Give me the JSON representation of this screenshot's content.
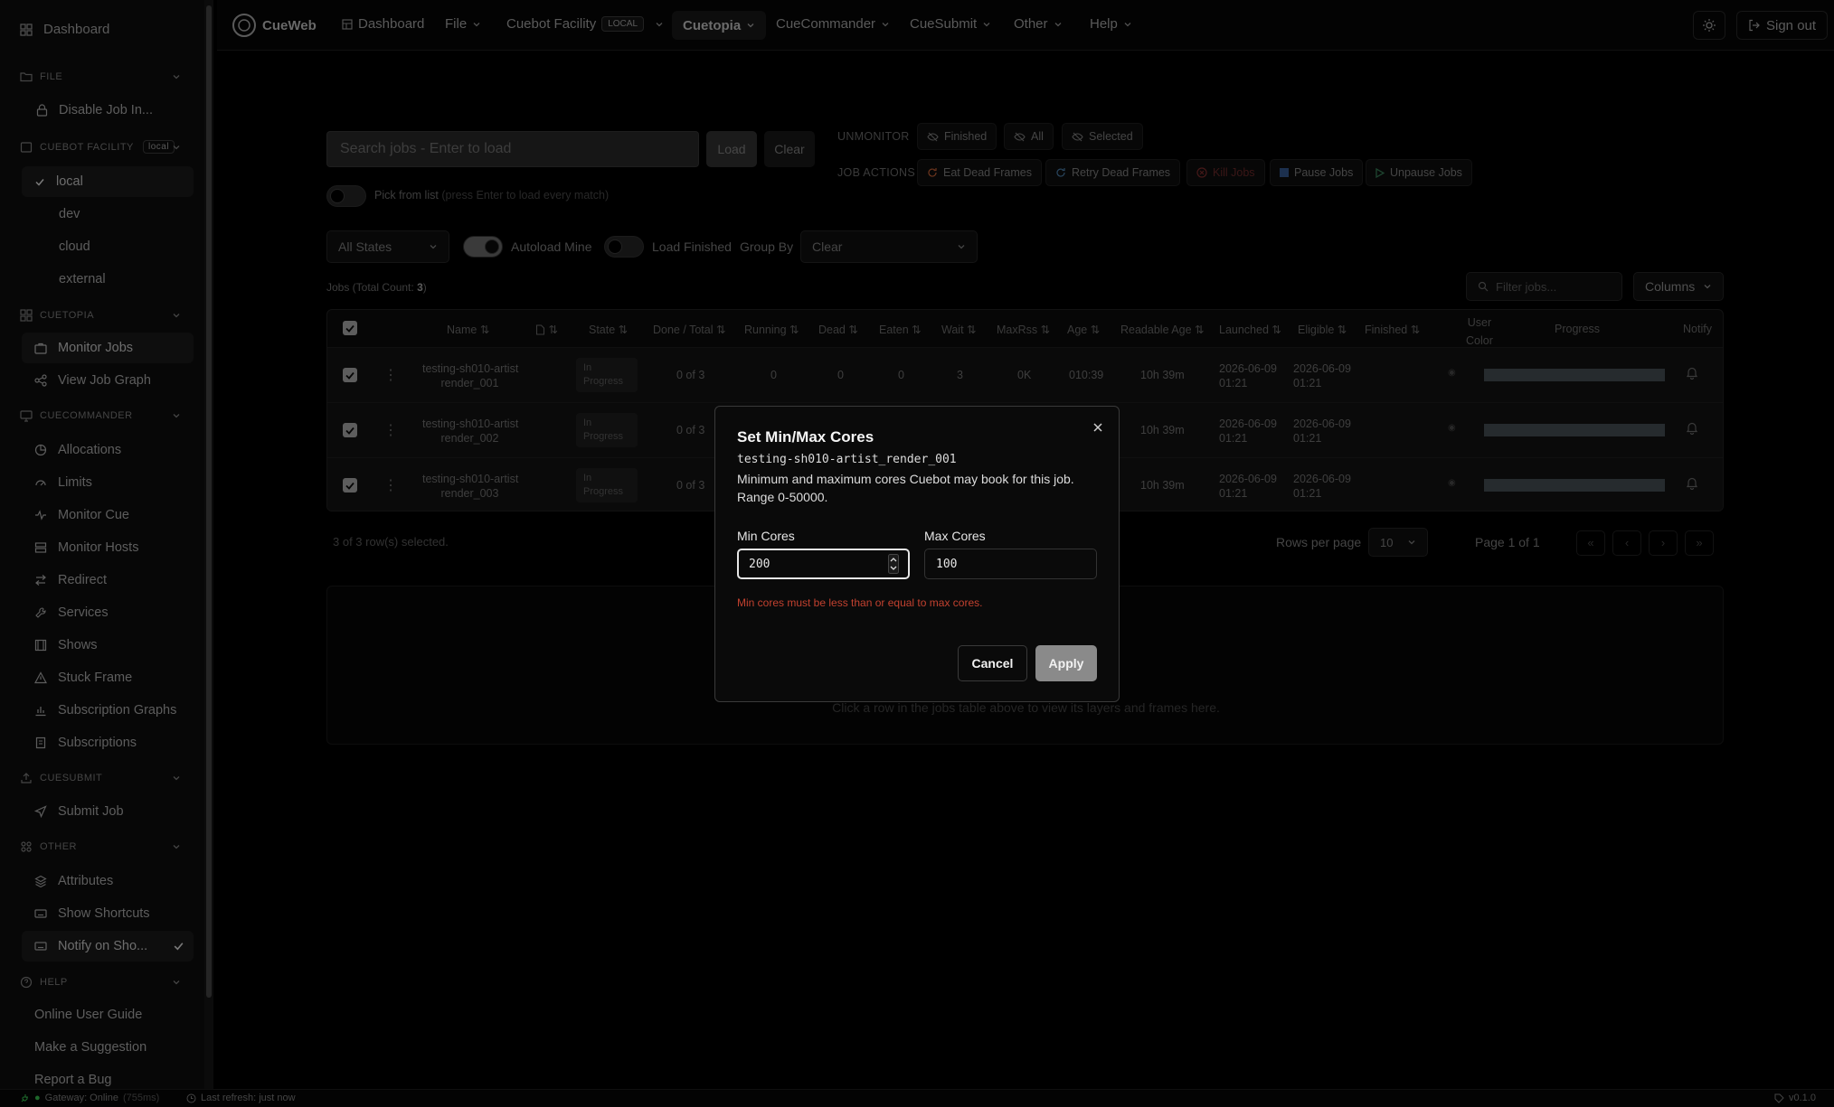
{
  "sidebar": {
    "dashboard": "Dashboard",
    "groups": {
      "file": "FILE",
      "cuebot_facility": "CUEBOT FACILITY",
      "cuebot_badge": "local",
      "cuetopia": "CUETOPIA",
      "cuecommander": "CUECOMMANDER",
      "cuesubmit": "CUESUBMIT",
      "other": "OTHER",
      "help": "HELP"
    },
    "items": {
      "disable_job": "Disable Job In...",
      "local": "local",
      "dev": "dev",
      "cloud": "cloud",
      "external": "external",
      "monitor_jobs": "Monitor Jobs",
      "view_job_graph": "View Job Graph",
      "allocations": "Allocations",
      "limits": "Limits",
      "monitor_cue": "Monitor Cue",
      "monitor_hosts": "Monitor Hosts",
      "redirect": "Redirect",
      "services": "Services",
      "shows": "Shows",
      "stuck_frame": "Stuck Frame",
      "subscription_graphs": "Subscription Graphs",
      "subscriptions": "Subscriptions",
      "submit_job": "Submit Job",
      "attributes": "Attributes",
      "show_shortcuts": "Show Shortcuts",
      "notify_on_show": "Notify on Sho...",
      "online_user_guide": "Online User Guide",
      "make_suggestion": "Make a Suggestion",
      "report_bug": "Report a Bug"
    }
  },
  "topbar": {
    "brand": "CueWeb",
    "dashboard": "Dashboard",
    "file": "File",
    "facility": "Cuebot Facility",
    "facility_badge": "LOCAL",
    "cuetopia": "Cuetopia",
    "cuecommander": "CueCommander",
    "cuesubmit": "CueSubmit",
    "other": "Other",
    "help": "Help",
    "sign_out": "Sign out"
  },
  "toolbar": {
    "search_placeholder": "Search jobs - Enter to load",
    "load": "Load",
    "clear": "Clear",
    "unmonitor_label": "UNMONITOR",
    "finished": "Finished",
    "all": "All",
    "selected": "Selected",
    "job_actions_label": "JOB ACTIONS",
    "eat_dead_frames": "Eat Dead Frames",
    "retry_dead_frames": "Retry Dead Frames",
    "kill_jobs": "Kill Jobs",
    "pause_jobs": "Pause Jobs",
    "unpause_jobs": "Unpause Jobs",
    "pick_from_list": "Pick from list",
    "pick_hint": "(press Enter to load every match)",
    "all_states": "All States",
    "autoload_mine": "Autoload Mine",
    "load_finished": "Load Finished",
    "group_by": "Group By",
    "group_by_value": "Clear"
  },
  "jobs": {
    "count_label": "Jobs (Total Count: ",
    "count": "3",
    "count_close": ")",
    "filter_placeholder": "Filter jobs...",
    "columns_btn": "Columns",
    "headers": {
      "name": "Name",
      "state": "State",
      "done_total": "Done / Total",
      "running": "Running",
      "dead": "Dead",
      "eaten": "Eaten",
      "wait": "Wait",
      "maxrss": "MaxRss",
      "age": "Age",
      "readable_age": "Readable Age",
      "launched": "Launched",
      "eligible": "Eligible",
      "finished": "Finished",
      "user_color_1": "User",
      "user_color_2": "Color",
      "progress": "Progress",
      "notify": "Notify"
    },
    "rows": [
      {
        "name1": "testing-sh010-artist",
        "name2": "render_001",
        "state1": "In",
        "state2": "Progress",
        "done": "0 of 3",
        "running": "0",
        "dead": "0",
        "eaten": "0",
        "wait": "3",
        "maxrss": "0K",
        "age": "010:39",
        "readable_age": "10h 39m",
        "launched1": "2026-06-09",
        "launched2": "01:21",
        "eligible1": "2026-06-09",
        "eligible2": "01:21",
        "progress": 1.0
      },
      {
        "name1": "testing-sh010-artist",
        "name2": "render_002",
        "state1": "In",
        "state2": "Progress",
        "done": "0 of 3",
        "readable_age": "10h 39m",
        "launched1": "2026-06-09",
        "launched2": "01:21",
        "eligible1": "2026-06-09",
        "eligible2": "01:21",
        "progress": 1.0
      },
      {
        "name1": "testing-sh010-artist",
        "name2": "render_003",
        "state1": "In",
        "state2": "Progress",
        "done": "0 of 3",
        "readable_age": "10h 39m",
        "launched1": "2026-06-09",
        "launched2": "01:21",
        "eligible1": "2026-06-09",
        "eligible2": "01:21",
        "progress": 1.0
      }
    ],
    "selected_text": "3 of 3 row(s) selected.",
    "rows_per_page": "Rows per page",
    "rows_per_page_value": "10",
    "page_text": "Page 1 of 1"
  },
  "lower_panel": {
    "hint": "Click a row in the jobs table above to view its layers and frames here."
  },
  "modal": {
    "title": "Set Min/Max Cores",
    "job_name": "testing-sh010-artist_render_001",
    "description": "Minimum and maximum cores Cuebot may book for this job. Range 0-50000.",
    "min_label": "Min Cores",
    "min_value": "200",
    "max_label": "Max Cores",
    "max_value": "100",
    "error": "Min cores must be less than or equal to max cores.",
    "cancel": "Cancel",
    "apply": "Apply"
  },
  "footer": {
    "gateway": "Gateway: Online",
    "latency": "(755ms)",
    "last_refresh": "Last refresh: just now",
    "version": "v0.1.0"
  },
  "colors": {
    "error": "#c2412f",
    "progress_bar": "#3b4248",
    "accent_green": "#2ea043"
  }
}
